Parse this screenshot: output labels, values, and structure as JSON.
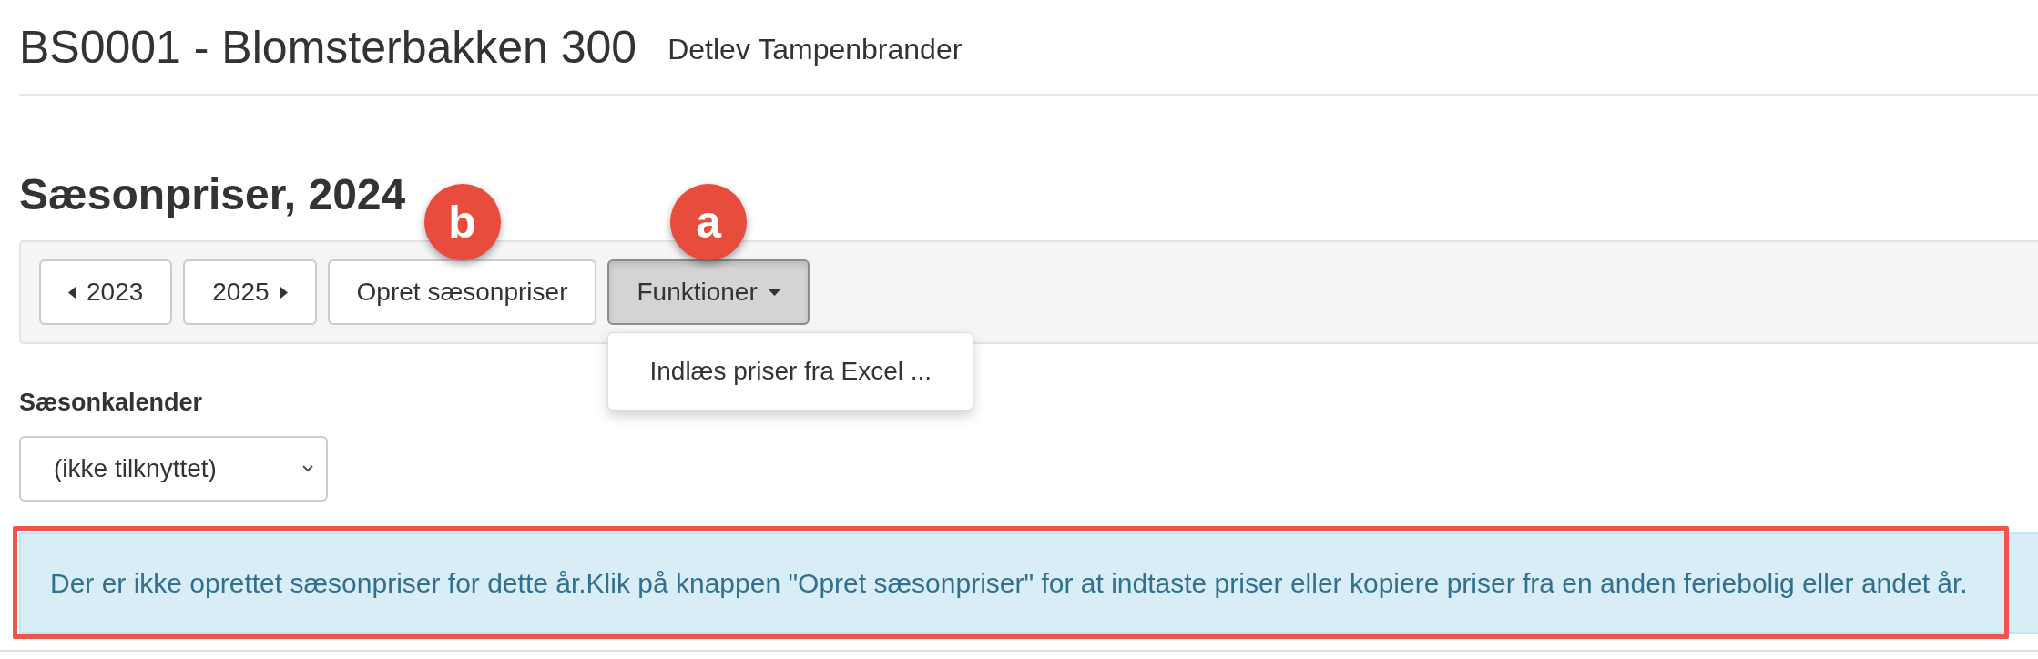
{
  "header": {
    "title": "BS0001 - Blomsterbakken 300",
    "subtitle": "Detlev Tampenbrander"
  },
  "section": {
    "title": "Sæsonpriser, 2024"
  },
  "toolbar": {
    "buttons": [
      {
        "kind": "prev",
        "label": "2023"
      },
      {
        "kind": "next",
        "label": "2025"
      },
      {
        "kind": "plain",
        "label": "Opret sæsonpriser",
        "annotation": "b"
      },
      {
        "kind": "dropdown",
        "label": "Funktioner",
        "annotation": "a",
        "expanded": true,
        "menu": [
          "Indlæs priser fra Excel ..."
        ]
      }
    ]
  },
  "calendar": {
    "label": "Sæsonkalender",
    "value": "(ikke tilknyttet)"
  },
  "alert": {
    "text": "Der er ikke oprettet sæsonpriser for dette år.Klik på knappen \"Opret sæsonpriser\" for at indtaste priser eller kopiere priser fra en anden feriebolig eller andet år.",
    "highlighted": true
  }
}
